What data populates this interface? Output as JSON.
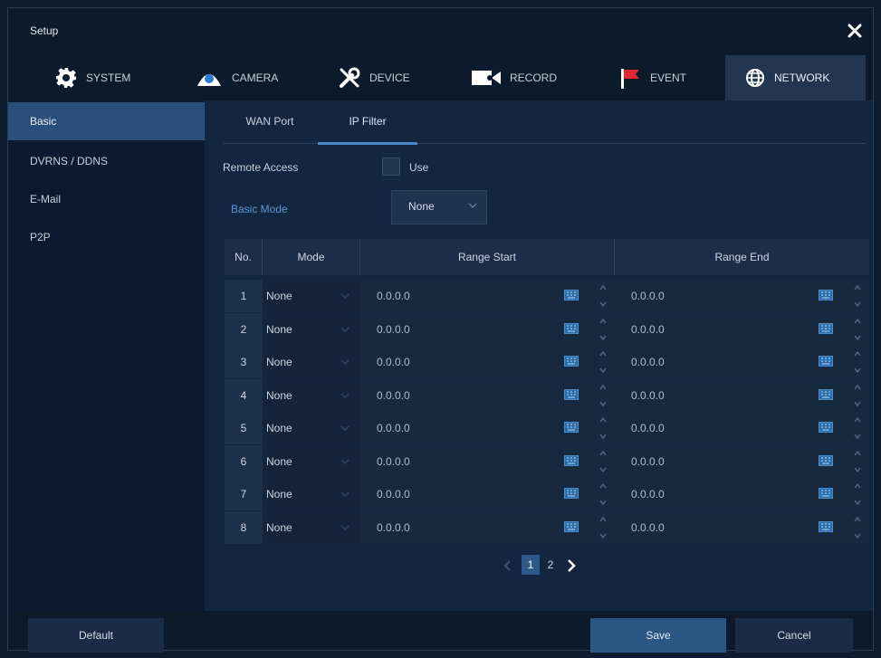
{
  "window": {
    "title": "Setup"
  },
  "tabs": [
    {
      "label": "SYSTEM",
      "icon": "gear-icon"
    },
    {
      "label": "CAMERA",
      "icon": "camera-icon"
    },
    {
      "label": "DEVICE",
      "icon": "tools-icon"
    },
    {
      "label": "RECORD",
      "icon": "video-camera-icon"
    },
    {
      "label": "EVENT",
      "icon": "flag-icon"
    },
    {
      "label": "NETWORK",
      "icon": "globe-icon",
      "active": true
    }
  ],
  "sidebar": {
    "items": [
      {
        "label": "Basic",
        "active": true
      },
      {
        "label": "DVRNS / DDNS"
      },
      {
        "label": "E-Mail"
      },
      {
        "label": "P2P"
      }
    ]
  },
  "subtabs": [
    {
      "label": "WAN Port"
    },
    {
      "label": "IP Filter",
      "active": true
    }
  ],
  "remote_access": {
    "label": "Remote Access",
    "checkbox_label": "Use",
    "checked": false
  },
  "basic_mode": {
    "label": "Basic Mode",
    "value": "None"
  },
  "table": {
    "headers": {
      "no": "No.",
      "mode": "Mode",
      "range_start": "Range Start",
      "range_end": "Range End"
    },
    "rows": [
      {
        "no": "1",
        "mode": "None",
        "start": "0.0.0.0",
        "end": "0.0.0.0"
      },
      {
        "no": "2",
        "mode": "None",
        "start": "0.0.0.0",
        "end": "0.0.0.0"
      },
      {
        "no": "3",
        "mode": "None",
        "start": "0.0.0.0",
        "end": "0.0.0.0"
      },
      {
        "no": "4",
        "mode": "None",
        "start": "0.0.0.0",
        "end": "0.0.0.0"
      },
      {
        "no": "5",
        "mode": "None",
        "start": "0.0.0.0",
        "end": "0.0.0.0"
      },
      {
        "no": "6",
        "mode": "None",
        "start": "0.0.0.0",
        "end": "0.0.0.0"
      },
      {
        "no": "7",
        "mode": "None",
        "start": "0.0.0.0",
        "end": "0.0.0.0"
      },
      {
        "no": "8",
        "mode": "None",
        "start": "0.0.0.0",
        "end": "0.0.0.0"
      }
    ]
  },
  "pagination": {
    "pages": [
      "1",
      "2"
    ],
    "current": "1"
  },
  "footer": {
    "default_label": "Default",
    "save_label": "Save",
    "cancel_label": "Cancel"
  },
  "colors": {
    "accent": "#4a86c8",
    "active_side": "#2a4f7a",
    "save_button": "#2a5784",
    "event_flag": "#e0282e"
  }
}
